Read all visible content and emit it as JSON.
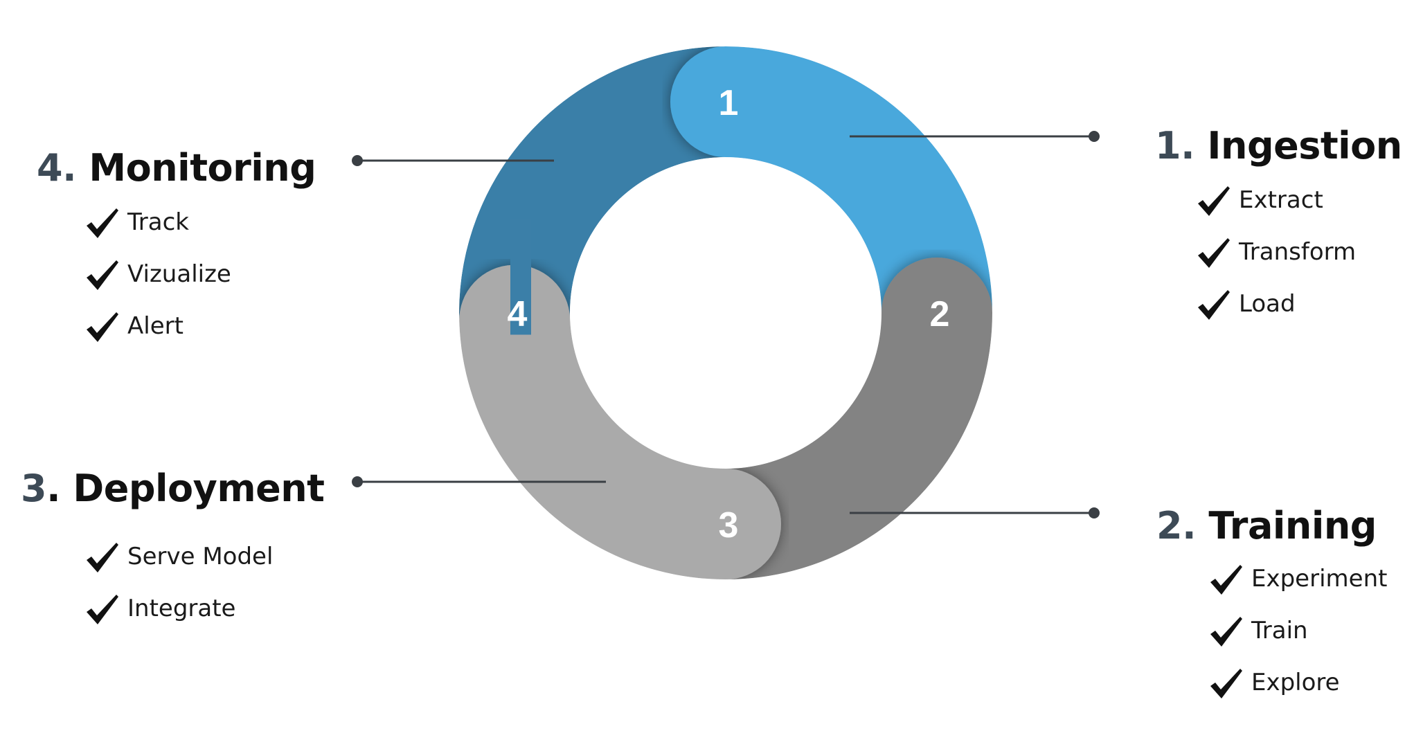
{
  "diagram": {
    "type": "cycle",
    "colors": {
      "segment_1": "#4aa8dc",
      "segment_2": "#838383",
      "segment_3": "#aaaaaa",
      "segment_4": "#3a7fa8",
      "numeral": "#3d4a56",
      "connector": "#3a3f44"
    },
    "segments": [
      {
        "number": "1"
      },
      {
        "number": "2"
      },
      {
        "number": "3"
      },
      {
        "number": "4"
      }
    ]
  },
  "stages": [
    {
      "numeral": "1",
      "dot": ".",
      "title": "Ingestion",
      "items": [
        "Extract",
        "Transform",
        "Load"
      ]
    },
    {
      "numeral": "2",
      "dot": ".",
      "title": "Training",
      "items": [
        "Experiment",
        "Train",
        "Explore"
      ]
    },
    {
      "numeral": "3",
      "dot": ".",
      "title": "Deployment",
      "items": [
        "Serve Model",
        "Integrate"
      ]
    },
    {
      "numeral": "4",
      "dot": ".",
      "title": "Monitoring",
      "items": [
        "Track",
        "Vizualize",
        "Alert"
      ]
    }
  ]
}
